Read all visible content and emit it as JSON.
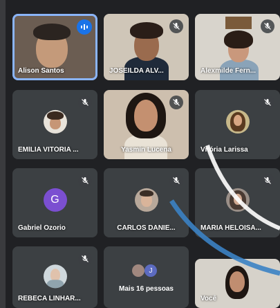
{
  "participants": [
    {
      "name": "Alison Santos",
      "status": "speaking"
    },
    {
      "name": "JOSEILDA ALV...",
      "status": "muted"
    },
    {
      "name": "Alexmilde Fern...",
      "status": "muted"
    },
    {
      "name": "EMÍLIA VITÓRIA ...",
      "status": "muted"
    },
    {
      "name": "Yasmin Lucena",
      "status": "muted"
    },
    {
      "name": "Vitória Larissa",
      "status": "muted"
    },
    {
      "name": "Gabriel Ozorio",
      "initial": "G",
      "status": "muted"
    },
    {
      "name": "CARLOS DANIE...",
      "status": "muted"
    },
    {
      "name": "MARIA HELOISA...",
      "status": "muted"
    },
    {
      "name": "REBECA LINHAR...",
      "status": "muted"
    },
    {
      "name": "Você",
      "status": "self"
    }
  ],
  "more_people": {
    "label": "Mais 16 pessoas",
    "avatar_initial": "J"
  },
  "colors": {
    "background": "#202124",
    "tile": "#3c4043",
    "accent": "#1a73e8",
    "avatar_g": "#7b4fd1"
  }
}
